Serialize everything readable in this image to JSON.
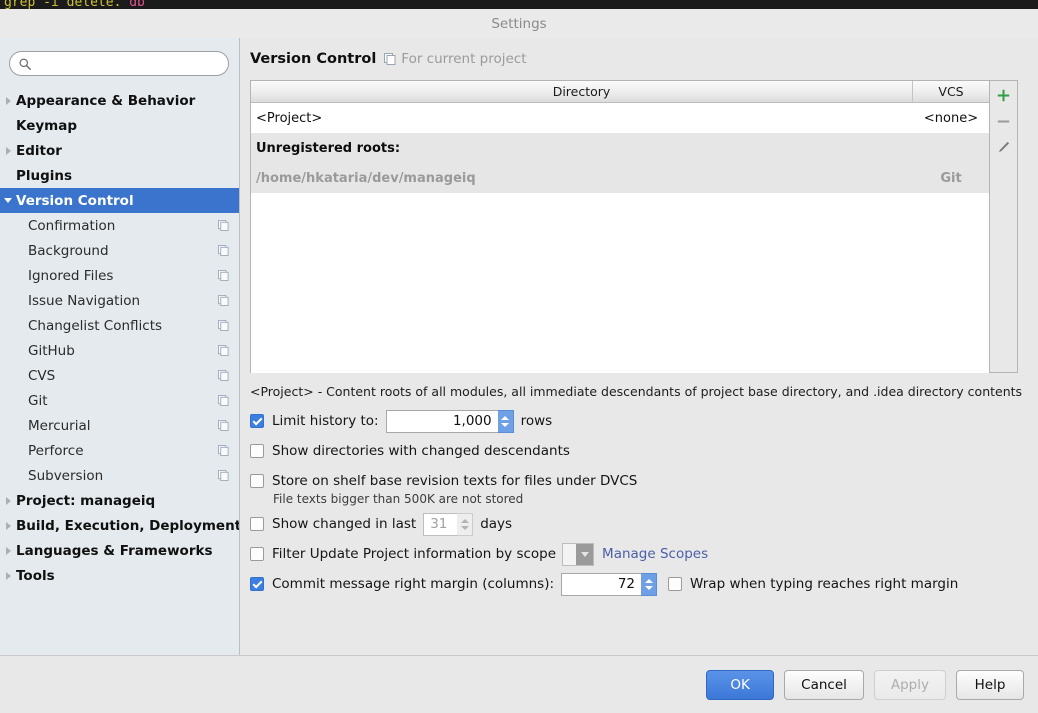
{
  "terminal": {
    "text_a": "grep -i delete.",
    "text_b": "db"
  },
  "window": {
    "title": "Settings"
  },
  "search": {
    "value": "",
    "placeholder": "",
    "icon": "search-icon"
  },
  "sidebar": {
    "items": [
      {
        "label": "Appearance & Behavior",
        "level": "top",
        "arrow": "collapsed",
        "selected": false,
        "config_icon": false
      },
      {
        "label": "Keymap",
        "level": "top",
        "arrow": "none",
        "selected": false,
        "config_icon": false
      },
      {
        "label": "Editor",
        "level": "top",
        "arrow": "collapsed",
        "selected": false,
        "config_icon": false
      },
      {
        "label": "Plugins",
        "level": "top",
        "arrow": "none",
        "selected": false,
        "config_icon": false
      },
      {
        "label": "Version Control",
        "level": "top",
        "arrow": "expanded",
        "selected": true,
        "config_icon": false
      },
      {
        "label": "Confirmation",
        "level": "child",
        "arrow": "none",
        "selected": false,
        "config_icon": true
      },
      {
        "label": "Background",
        "level": "child",
        "arrow": "none",
        "selected": false,
        "config_icon": true
      },
      {
        "label": "Ignored Files",
        "level": "child",
        "arrow": "none",
        "selected": false,
        "config_icon": true
      },
      {
        "label": "Issue Navigation",
        "level": "child",
        "arrow": "none",
        "selected": false,
        "config_icon": true
      },
      {
        "label": "Changelist Conflicts",
        "level": "child",
        "arrow": "none",
        "selected": false,
        "config_icon": true
      },
      {
        "label": "GitHub",
        "level": "child",
        "arrow": "none",
        "selected": false,
        "config_icon": true
      },
      {
        "label": "CVS",
        "level": "child",
        "arrow": "none",
        "selected": false,
        "config_icon": true
      },
      {
        "label": "Git",
        "level": "child",
        "arrow": "none",
        "selected": false,
        "config_icon": true
      },
      {
        "label": "Mercurial",
        "level": "child",
        "arrow": "none",
        "selected": false,
        "config_icon": true
      },
      {
        "label": "Perforce",
        "level": "child",
        "arrow": "none",
        "selected": false,
        "config_icon": true
      },
      {
        "label": "Subversion",
        "level": "child",
        "arrow": "none",
        "selected": false,
        "config_icon": true
      },
      {
        "label": "Project: manageiq",
        "level": "top",
        "arrow": "collapsed",
        "selected": false,
        "config_icon": false
      },
      {
        "label": "Build, Execution, Deployment",
        "level": "top",
        "arrow": "collapsed",
        "selected": false,
        "config_icon": false
      },
      {
        "label": "Languages & Frameworks",
        "level": "top",
        "arrow": "collapsed",
        "selected": false,
        "config_icon": false
      },
      {
        "label": "Tools",
        "level": "top",
        "arrow": "collapsed",
        "selected": false,
        "config_icon": false
      }
    ]
  },
  "main": {
    "page_title": "Version Control",
    "scope_label": "For current project",
    "scope_icon": "project-scope-icon",
    "table": {
      "columns": [
        "Directory",
        "VCS"
      ],
      "rows": [
        {
          "directory": "<Project>",
          "vcs": "<none>",
          "style": "project"
        },
        {
          "directory": "Unregistered roots:",
          "vcs": "",
          "style": "header-row"
        },
        {
          "directory": "/home/hkataria/dev/manageiq",
          "vcs": "Git",
          "style": "unreg"
        }
      ]
    },
    "toolbar": {
      "add_label": "+",
      "remove_label": "−",
      "edit_icon": "pencil-icon"
    },
    "description": "<Project> - Content roots of all modules, all immediate descendants of project base directory, and .idea directory contents",
    "options": {
      "limit_history": {
        "label": "Limit history to:",
        "checked": true,
        "value": "1,000",
        "suffix": "rows",
        "enabled": true
      },
      "show_dirs_changed": {
        "label": "Show directories with changed descendants",
        "checked": false
      },
      "store_on_shelf": {
        "label": "Store on shelf base revision texts for files under DVCS",
        "checked": false,
        "note": "File texts bigger than 500K are not stored"
      },
      "show_changed_last": {
        "label": "Show changed in last",
        "checked": false,
        "value": "31",
        "suffix": "days",
        "enabled": false
      },
      "filter_by_scope": {
        "label": "Filter Update Project information by scope",
        "checked": false,
        "combo_value": "",
        "link_label": "Manage Scopes"
      },
      "commit_right_margin": {
        "label": "Commit message right margin (columns):",
        "checked": true,
        "value": "72",
        "enabled": true,
        "wrap_label": "Wrap when typing reaches right margin",
        "wrap_checked": false
      }
    }
  },
  "footer": {
    "buttons": [
      {
        "label": "OK",
        "style": "primary",
        "enabled": true
      },
      {
        "label": "Cancel",
        "style": "normal",
        "enabled": true
      },
      {
        "label": "Apply",
        "style": "disabled",
        "enabled": false
      },
      {
        "label": "Help",
        "style": "normal",
        "enabled": true
      }
    ]
  },
  "colors": {
    "accent_selected": "#3b74cd",
    "primary_button": "#3c78d8",
    "checkbox_checked": "#3d7fe0",
    "link": "#4a5fa8",
    "add_icon": "#2f9e44",
    "sidebar_bg": "#e4eaed",
    "panel_bg": "#e8e8e8"
  }
}
